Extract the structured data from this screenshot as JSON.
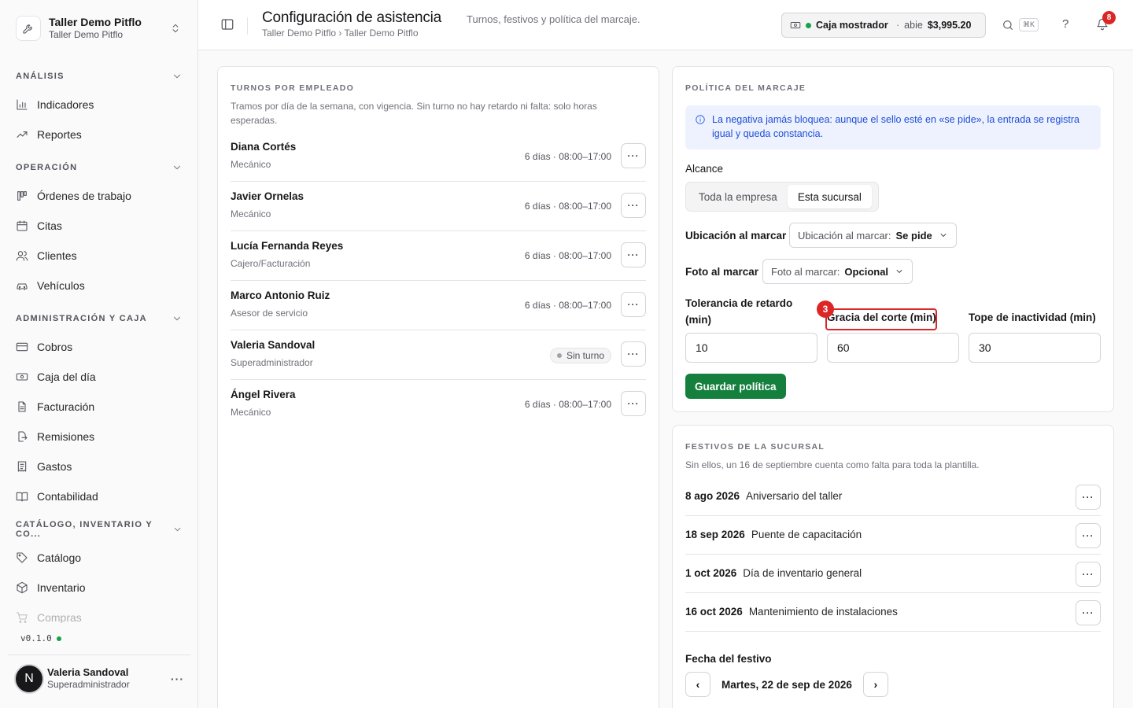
{
  "brand": {
    "name": "Taller Demo Pitflo",
    "branch": "Taller Demo Pitflo"
  },
  "nav": {
    "sections": [
      {
        "label": "ANÁLISIS",
        "items": [
          "Indicadores",
          "Reportes"
        ]
      },
      {
        "label": "OPERACIÓN",
        "items": [
          "Órdenes de trabajo",
          "Citas",
          "Clientes",
          "Vehículos"
        ]
      },
      {
        "label": "ADMINISTRACIÓN Y CAJA",
        "items": [
          "Cobros",
          "Caja del día",
          "Facturación",
          "Remisiones",
          "Gastos",
          "Contabilidad"
        ]
      },
      {
        "label": "CATÁLOGO, INVENTARIO Y CO...",
        "items": [
          "Catálogo",
          "Inventario",
          "Compras"
        ]
      }
    ]
  },
  "version": "v0.1.0",
  "user": {
    "initial": "N",
    "name": "Valeria Sandoval",
    "role": "Superadministrador"
  },
  "header": {
    "title": "Configuración de asistencia",
    "subtitle": "Turnos, festivos y política del marcaje.",
    "breadcrumb": "Taller Demo Pitflo › Taller Demo Pitflo",
    "cash": {
      "name": "Caja mostrador",
      "status": "abie",
      "amount": "$3,995.20"
    },
    "shortcut": "⌘K",
    "help": "?",
    "notifications": "8"
  },
  "shifts": {
    "title": "TURNOS POR EMPLEADO",
    "description": "Tramos por día de la semana, con vigencia. Sin turno no hay retardo ni falta: solo horas esperadas.",
    "employees": [
      {
        "name": "Diana Cortés",
        "role": "Mecánico",
        "schedule": "6 días · 08:00–17:00"
      },
      {
        "name": "Javier Ornelas",
        "role": "Mecánico",
        "schedule": "6 días · 08:00–17:00"
      },
      {
        "name": "Lucía Fernanda Reyes",
        "role": "Cajero/Facturación",
        "schedule": "6 días · 08:00–17:00"
      },
      {
        "name": "Marco Antonio Ruiz",
        "role": "Asesor de servicio",
        "schedule": "6 días · 08:00–17:00"
      },
      {
        "name": "Valeria Sandoval",
        "role": "Superadministrador",
        "schedule": "Sin turno"
      },
      {
        "name": "Ángel Rivera",
        "role": "Mecánico",
        "schedule": "6 días · 08:00–17:00"
      }
    ],
    "more_label": "···"
  },
  "policy": {
    "title": "POLÍTICA DEL MARCAJE",
    "alert": "La negativa jamás bloquea: aunque el sello esté en «se pide», la entrada se registra igual y queda constancia.",
    "scope_label": "Alcance",
    "scope_options": [
      "Toda la empresa",
      "Esta sucursal"
    ],
    "location_label": "Ubicación al marcar",
    "location_select": {
      "prefix": "Ubicación al marcar:",
      "value": "Se pide"
    },
    "photo_label": "Foto al marcar",
    "photo_select": {
      "prefix": "Foto al marcar:",
      "value": "Opcional"
    },
    "fields": [
      {
        "label": "Tolerancia de retardo (min)",
        "value": "10"
      },
      {
        "label": "Gracia del corte (min)",
        "value": "60"
      },
      {
        "label": "Tope de inactividad (min)",
        "value": "30"
      }
    ],
    "marker": "3",
    "save_label": "Guardar política"
  },
  "holidays": {
    "title": "FESTIVOS DE LA SUCURSAL",
    "description": "Sin ellos, un 16 de septiembre cuenta como falta para toda la plantilla.",
    "items": [
      {
        "date": "8 ago 2026",
        "name": "Aniversario del taller"
      },
      {
        "date": "18 sep 2026",
        "name": "Puente de capacitación"
      },
      {
        "date": "1 oct 2026",
        "name": "Día de inventario general"
      },
      {
        "date": "16 oct 2026",
        "name": "Mantenimiento de instalaciones"
      }
    ],
    "date_label": "Fecha del festivo",
    "current_date": "Martes, 22 de sep de 2026",
    "prev": "‹",
    "next": "›"
  },
  "icons": {
    "indicadores": "bar-chart-icon",
    "reportes": "trend-icon",
    "ordenes": "kanban-icon",
    "citas": "calendar-icon",
    "clientes": "users-icon",
    "vehiculos": "car-icon",
    "cobros": "credit-card-icon",
    "caja": "cash-icon",
    "facturacion": "file-text-icon",
    "remisiones": "file-export-icon",
    "gastos": "receipt-icon",
    "contabilidad": "book-icon",
    "catalogo": "tag-icon",
    "inventario": "box-icon",
    "compras": "cart-icon"
  },
  "colors": {
    "accent": "#15803d",
    "alert_bg": "#eef2fe",
    "alert_text": "#1d4ed8",
    "danger": "#dc2626",
    "online": "#16a34a"
  }
}
